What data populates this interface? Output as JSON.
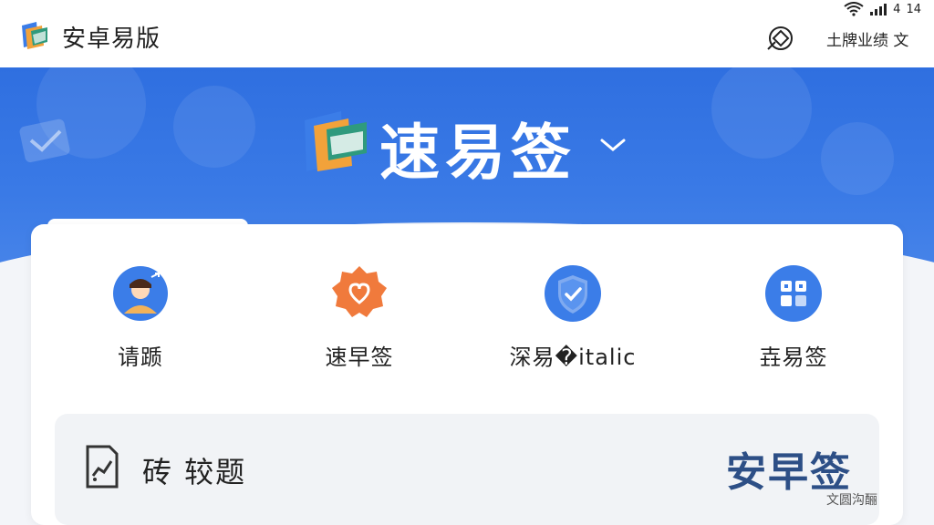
{
  "topbar": {
    "app_title": "安卓易版",
    "action_label": "土牌业绩 文",
    "status": {
      "signal": "4",
      "battery": "14"
    }
  },
  "header": {
    "title": "速易签"
  },
  "grid": [
    {
      "label": "请踬",
      "icon": "user-avatar-icon"
    },
    {
      "label": "速早签",
      "icon": "heart-badge-icon"
    },
    {
      "label": "深易�italic",
      "icon": "shield-check-icon"
    },
    {
      "label": "壵易签",
      "icon": "qr-grid-icon"
    }
  ],
  "panel": {
    "label": "砖 较题",
    "title": "安早签",
    "subtitle": "文圆沟酾"
  },
  "colors": {
    "accent": "#2f6fe0",
    "panel_title": "#2d4f86",
    "orange": "#f07a3c"
  }
}
